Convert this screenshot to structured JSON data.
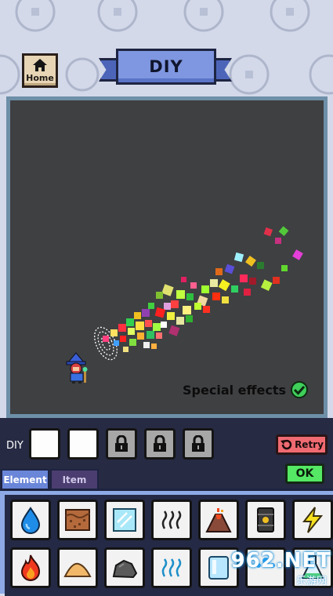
{
  "header": {
    "home_label": "Home",
    "title": "DIY"
  },
  "canvas": {
    "special_effects_label": "Special effects",
    "special_effects_enabled": true,
    "background_color": "#3f4042",
    "border_color": "#6e8fa8"
  },
  "diy_bar": {
    "label": "DIY",
    "slots": [
      {
        "state": "empty"
      },
      {
        "state": "empty"
      },
      {
        "state": "locked",
        "icon": "lock-icon"
      },
      {
        "state": "locked",
        "icon": "lock-icon"
      },
      {
        "state": "locked",
        "icon": "lock-icon"
      }
    ],
    "retry_label": "Retry",
    "ok_label": "OK"
  },
  "tabs": [
    {
      "label": "Element",
      "active": true
    },
    {
      "label": "Item",
      "active": false
    }
  ],
  "elements": [
    {
      "icon": "water-drop-icon"
    },
    {
      "icon": "soil-icon"
    },
    {
      "icon": "glass-icon"
    },
    {
      "icon": "steam-icon"
    },
    {
      "icon": "volcano-icon"
    },
    {
      "icon": "oil-barrel-icon"
    },
    {
      "icon": "lightning-icon"
    },
    {
      "icon": "fire-icon"
    },
    {
      "icon": "sand-icon"
    },
    {
      "icon": "stone-icon"
    },
    {
      "icon": "gas-icon"
    },
    {
      "icon": "ice-icon"
    },
    {
      "icon": "splash-icon"
    },
    {
      "icon": "flask-icon"
    }
  ],
  "watermark": {
    "top": "962.NET",
    "bottom": "乐游网"
  },
  "colors": {
    "accent_blue": "#7f97e0",
    "retry_red": "#f06a72",
    "ok_green": "#54e864",
    "panel_dark": "#262a43"
  }
}
